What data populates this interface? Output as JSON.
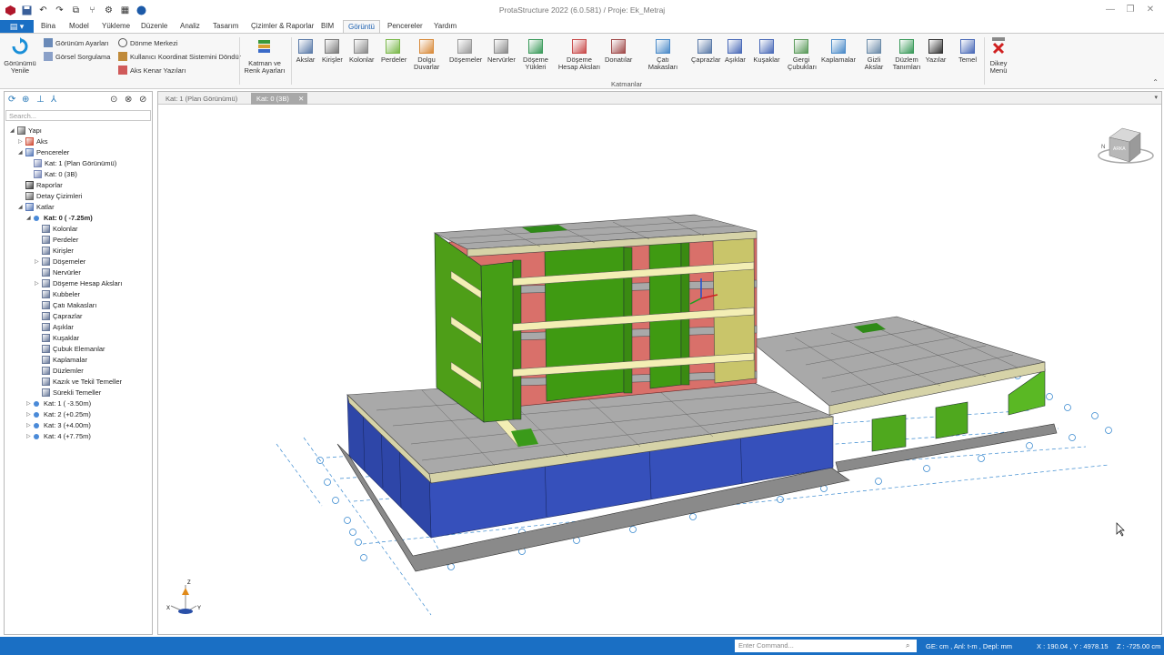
{
  "app": {
    "title": "ProtaStructure 2022 (6.0.581) / Proje: Ek_Metraj"
  },
  "menu": {
    "file_label": "▤ ▾",
    "tabs": [
      {
        "label": "Bina"
      },
      {
        "label": "Model"
      },
      {
        "label": "Yükleme"
      },
      {
        "label": "Düzenle"
      },
      {
        "label": "Analiz"
      },
      {
        "label": "Tasarım"
      },
      {
        "label": "Çizimler & Raporlar"
      },
      {
        "label": "BIM"
      },
      {
        "label": "Görüntü"
      },
      {
        "label": "Pencereler"
      },
      {
        "label": "Yardım"
      }
    ],
    "active": "Görüntü"
  },
  "ribbon": {
    "refresh": "Görünümü Yenile",
    "small_col1": [
      "Görünüm Ayarları",
      "Görsel Sorgulama"
    ],
    "small_col2": [
      "Dönme Merkezi",
      "Kullanıcı Koordinat Sistemini Döndür",
      "Aks Kenar Yazıları"
    ],
    "layer_color": "Katman ve Renk Ayarları",
    "layers": [
      {
        "label": "Akslar"
      },
      {
        "label": "Kirişler"
      },
      {
        "label": "Kolonlar"
      },
      {
        "label": "Perdeler"
      },
      {
        "label": "Dolgu Duvarlar"
      },
      {
        "label": "Döşemeler"
      },
      {
        "label": "Nervürler"
      },
      {
        "label": "Döşeme Yükleri"
      },
      {
        "label": "Döşeme Hesap Aksları"
      },
      {
        "label": "Donatılar"
      },
      {
        "label": "Çatı Makasları"
      },
      {
        "label": "Çaprazlar"
      },
      {
        "label": "Aşıklar"
      },
      {
        "label": "Kuşaklar"
      },
      {
        "label": "Gergi Çubukları"
      },
      {
        "label": "Kaplamalar"
      },
      {
        "label": "Gizli Akslar"
      },
      {
        "label": "Düzlem Tanımları"
      },
      {
        "label": "Yazılar"
      },
      {
        "label": "Temel"
      }
    ],
    "group_label": "Katmanlar",
    "vertical_menu": "Dikey Menü"
  },
  "panel": {
    "search_placeholder": "Search...",
    "tree": [
      {
        "label": "Yapı",
        "level": 0,
        "exp": "◢",
        "icon": "building-icon",
        "bold": false
      },
      {
        "label": "Aks",
        "level": 1,
        "exp": "▷",
        "icon": "grid-axis-icon",
        "bold": false
      },
      {
        "label": "Pencereler",
        "level": 1,
        "exp": "◢",
        "icon": "window-icon",
        "bold": false
      },
      {
        "label": "Kat: 1 (Plan Görünümü)",
        "level": 2,
        "exp": "",
        "icon": "view-icon",
        "bold": false
      },
      {
        "label": "Kat: 0 (3B)",
        "level": 2,
        "exp": "",
        "icon": "view-icon",
        "bold": false
      },
      {
        "label": "Raporlar",
        "level": 1,
        "exp": "",
        "icon": "printer-icon",
        "bold": false
      },
      {
        "label": "Detay Çizimleri",
        "level": 1,
        "exp": "",
        "icon": "drawing-icon",
        "bold": false
      },
      {
        "label": "Katlar",
        "level": 1,
        "exp": "◢",
        "icon": "floors-icon",
        "bold": false
      },
      {
        "label": "Kat: 0 ( -7.25m)",
        "level": 2,
        "exp": "◢",
        "icon": "floor-dot-icon",
        "bold": true
      },
      {
        "label": "Kolonlar",
        "level": 3,
        "exp": "",
        "icon": "column-icon",
        "bold": false
      },
      {
        "label": "Perdeler",
        "level": 3,
        "exp": "",
        "icon": "wall-icon",
        "bold": false
      },
      {
        "label": "Kirişler",
        "level": 3,
        "exp": "",
        "icon": "beam-icon",
        "bold": false
      },
      {
        "label": "Döşemeler",
        "level": 3,
        "exp": "▷",
        "icon": "slab-icon",
        "bold": false
      },
      {
        "label": "Nervürler",
        "level": 3,
        "exp": "",
        "icon": "rib-icon",
        "bold": false
      },
      {
        "label": "Döşeme Hesap Aksları",
        "level": 3,
        "exp": "▷",
        "icon": "slab-axis-icon",
        "bold": false
      },
      {
        "label": "Kubbeler",
        "level": 3,
        "exp": "",
        "icon": "dome-icon",
        "bold": false
      },
      {
        "label": "Çatı Makasları",
        "level": 3,
        "exp": "",
        "icon": "truss-icon",
        "bold": false
      },
      {
        "label": "Çaprazlar",
        "level": 3,
        "exp": "",
        "icon": "brace-icon",
        "bold": false
      },
      {
        "label": "Aşıklar",
        "level": 3,
        "exp": "",
        "icon": "purlin-icon",
        "bold": false
      },
      {
        "label": "Kuşaklar",
        "level": 3,
        "exp": "",
        "icon": "girt-icon",
        "bold": false
      },
      {
        "label": "Çubuk Elemanlar",
        "level": 3,
        "exp": "",
        "icon": "bar-element-icon",
        "bold": false
      },
      {
        "label": "Kaplamalar",
        "level": 3,
        "exp": "",
        "icon": "cladding-icon",
        "bold": false
      },
      {
        "label": "Düzlemler",
        "level": 3,
        "exp": "",
        "icon": "plane-icon",
        "bold": false
      },
      {
        "label": "Kazık ve Tekil Temeller",
        "level": 3,
        "exp": "",
        "icon": "pile-icon",
        "bold": false
      },
      {
        "label": "Sürekli Temeller",
        "level": 3,
        "exp": "",
        "icon": "strip-footing-icon",
        "bold": false
      },
      {
        "label": "Kat: 1 ( -3.50m)",
        "level": 2,
        "exp": "▷",
        "icon": "floor-dot-icon",
        "bold": false
      },
      {
        "label": "Kat: 2 (+0.25m)",
        "level": 2,
        "exp": "▷",
        "icon": "floor-dot-icon",
        "bold": false
      },
      {
        "label": "Kat: 3 (+4.00m)",
        "level": 2,
        "exp": "▷",
        "icon": "floor-dot-icon",
        "bold": false
      },
      {
        "label": "Kat: 4 (+7.75m)",
        "level": 2,
        "exp": "▷",
        "icon": "floor-dot-icon",
        "bold": false
      }
    ]
  },
  "viewport": {
    "tabs": [
      {
        "label": "Kat: 1 (Plan Görünümü)",
        "active": false
      },
      {
        "label": "Kat: 0 (3B)",
        "active": true
      }
    ],
    "close_glyph": "✕",
    "cube_label": "ARKA",
    "cube_side": "N",
    "axis_labels": {
      "z": "Z",
      "x": "X",
      "y": "Y"
    }
  },
  "status": {
    "command_placeholder": "Enter Command...",
    "units": "GE: cm , Anl: t-m , Depl: mm",
    "coords": "X : 190.04 , Y : 4978.15",
    "z": "Z : -725.00 cm"
  },
  "colors": {
    "accent": "#1a6fc4",
    "wall_green": "#3f9a1a",
    "wall_blue": "#3350b8",
    "slab_gray": "#a9a9a9",
    "beam_yellow": "#f3eeb4",
    "infill_red": "#d9706a"
  }
}
